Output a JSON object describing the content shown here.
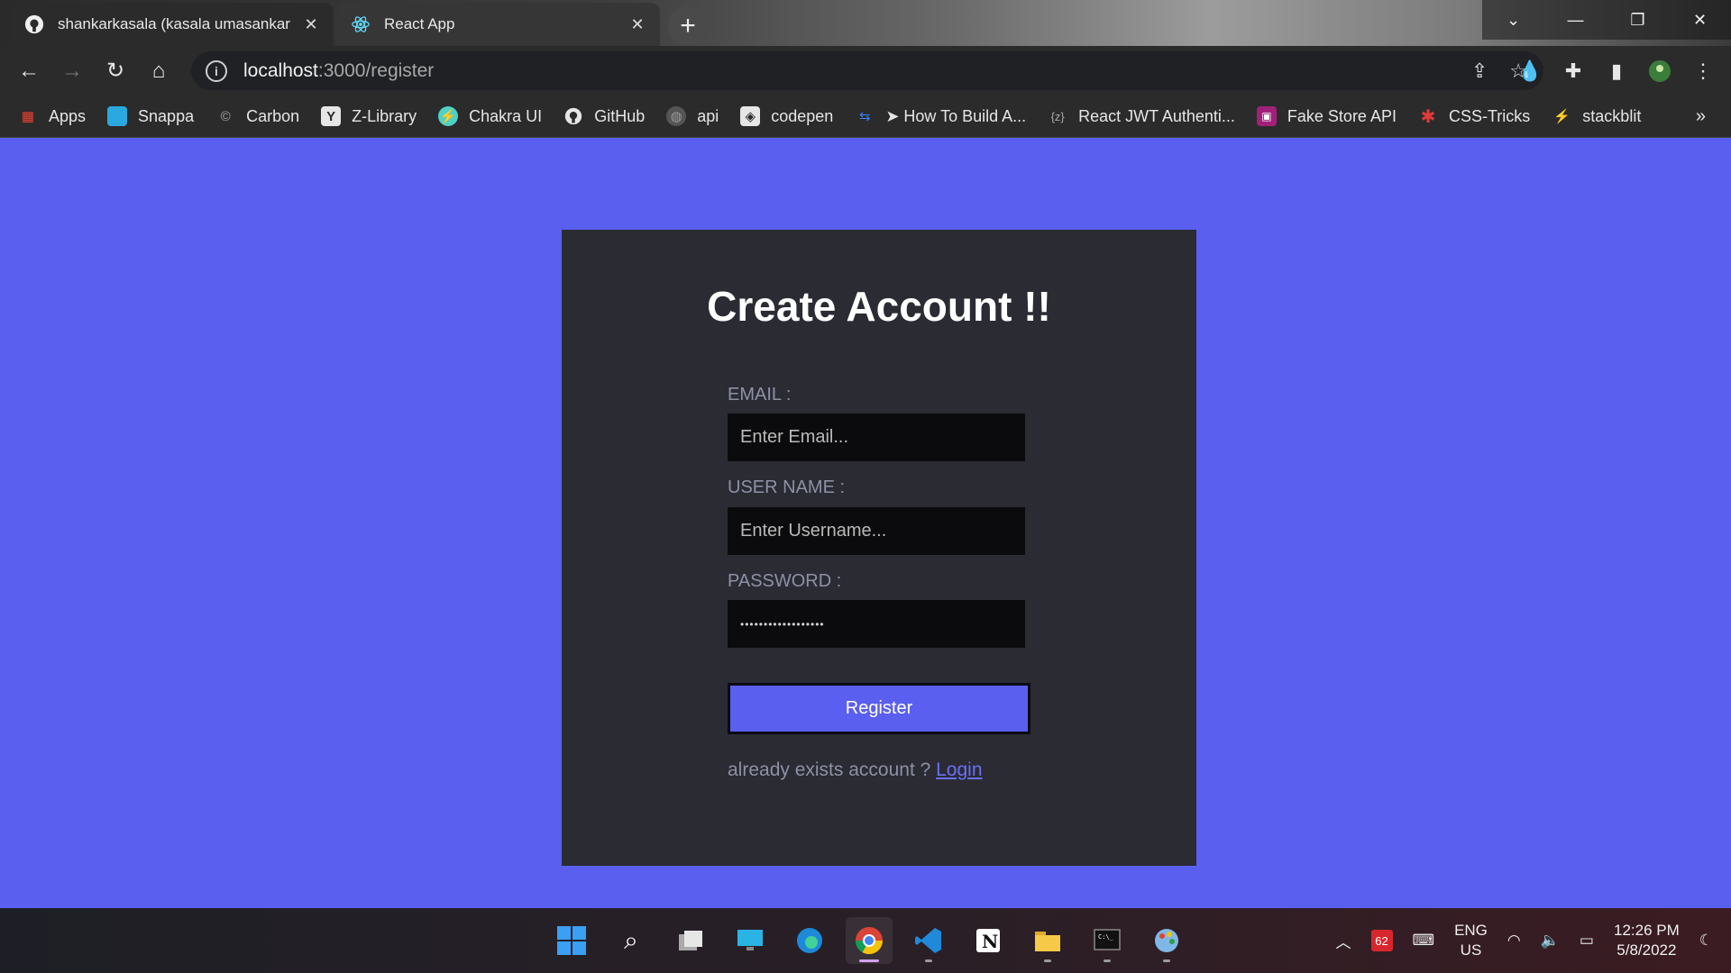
{
  "browser": {
    "tabs": [
      {
        "label": "shankarkasala (kasala umasankar",
        "icon": "github-icon"
      },
      {
        "label": "React App",
        "icon": "react-icon"
      }
    ],
    "url_host": "localhost",
    "url_path": ":3000/register",
    "bookmarks": [
      {
        "label": "Apps",
        "icon": "apps-grid-icon",
        "color": "#ea4335"
      },
      {
        "label": "Snappa",
        "icon": "snappa-icon",
        "color": "#2aa9e0"
      },
      {
        "label": "Carbon",
        "icon": "carbon-icon",
        "color": "#444444"
      },
      {
        "label": "Z-Library",
        "icon": "zlibrary-icon",
        "color": "#e6e6e6"
      },
      {
        "label": "Chakra UI",
        "icon": "chakra-icon",
        "color": "#4fd1c5"
      },
      {
        "label": "GitHub",
        "icon": "github-icon",
        "color": "#e6e6e6"
      },
      {
        "label": "api",
        "icon": "globe-icon",
        "color": "#777777"
      },
      {
        "label": "codepen",
        "icon": "codepen-icon",
        "color": "#e6e6e6"
      },
      {
        "label": "➤ How To Build A...",
        "icon": "link-icon",
        "color": "#3b82f6"
      },
      {
        "label": "React JWT Authenti...",
        "icon": "jwt-icon",
        "color": "#888888"
      },
      {
        "label": "Fake Store API",
        "icon": "fakestore-icon",
        "color": "#a0207a"
      },
      {
        "label": "CSS-Tricks",
        "icon": "csstricks-icon",
        "color": "#e23a3a"
      },
      {
        "label": "stackblit",
        "icon": "stackblitz-icon",
        "color": "#1389fd"
      }
    ]
  },
  "page": {
    "title": "Create Account !!",
    "email": {
      "label": "EMAIL :",
      "placeholder": "Enter Email..."
    },
    "username": {
      "label": "USER NAME :",
      "placeholder": "Enter Username..."
    },
    "password": {
      "label": "PASSWORD :",
      "value": "••••••••••••••••••"
    },
    "register_label": "Register",
    "footer_text": "already exists account ? ",
    "login_link": "Login"
  },
  "taskbar": {
    "lang_top": "ENG",
    "lang_bottom": "US",
    "time": "12:26 PM",
    "date": "5/8/2022",
    "badge": "62"
  },
  "colors": {
    "page_bg": "#5b5fef",
    "card_bg": "#2a2b33",
    "accent": "#5b5fef"
  }
}
